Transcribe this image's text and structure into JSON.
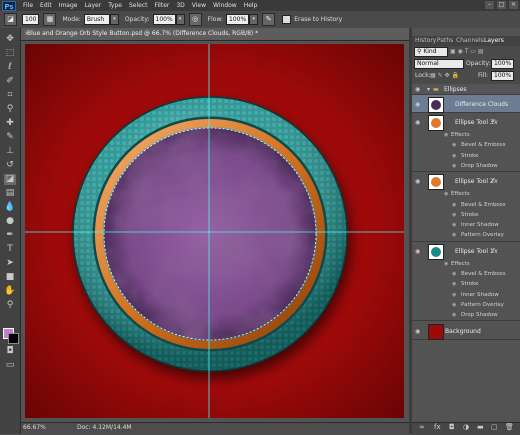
{
  "menu": {
    "logo": "Ps",
    "items": [
      "File",
      "Edit",
      "Image",
      "Layer",
      "Type",
      "Select",
      "Filter",
      "3D",
      "View",
      "Window",
      "Help"
    ]
  },
  "window_controls": {
    "minimize": "–",
    "maximize": "□",
    "close": "×"
  },
  "options_bar": {
    "brush_size": "100",
    "mode_label": "Mode:",
    "mode_value": "Brush",
    "opacity_label": "Opacity:",
    "opacity_value": "100%",
    "flow_label": "Flow:",
    "flow_value": "100%",
    "erase_history_label": "Erase to History"
  },
  "document": {
    "tab_title": "Blue and Orange Orb Style Button.psd @ 66.7% (Difference Clouds, RGB/8) *",
    "zoom": "66.67%",
    "doc_size": "Doc: 4.12M/14.4M",
    "canvas_color": "#9e0a0a"
  },
  "panel_tabs": [
    "History",
    "Paths",
    "Channels",
    "Layers"
  ],
  "active_panel_tab": "Layers",
  "layers_panel": {
    "filter_label": "Kind",
    "blend_mode": "Normal",
    "opacity_label": "Opacity:",
    "opacity_value": "100%",
    "lock_label": "Lock:",
    "fill_label": "Fill:",
    "fill_value": "100%",
    "group_name": "Ellipses",
    "layers": [
      {
        "name": "Difference Clouds",
        "thumb": "#4a2a5a",
        "selected": true,
        "effects_label": "",
        "effects": []
      },
      {
        "name": "Ellipse Tool 3",
        "thumb": "#e07a2a",
        "selected": false,
        "effects_label": "Effects",
        "effects": [
          "Bevel & Emboss",
          "Stroke",
          "Drop Shadow"
        ]
      },
      {
        "name": "Ellipse Tool 2",
        "thumb": "#e07a2a",
        "selected": false,
        "effects_label": "Effects",
        "effects": [
          "Bevel & Emboss",
          "Stroke",
          "Inner Shadow",
          "Pattern Overlay"
        ]
      },
      {
        "name": "Ellipse Tool 1",
        "thumb": "#1a8a88",
        "selected": false,
        "effects_label": "Effects",
        "effects": [
          "Bevel & Emboss",
          "Stroke",
          "Inner Shadow",
          "Pattern Overlay",
          "Drop Shadow"
        ]
      },
      {
        "name": "Background",
        "thumb": "#9e0a0a",
        "selected": false,
        "effects_label": "",
        "effects": []
      }
    ],
    "fx_badge": "fx"
  }
}
